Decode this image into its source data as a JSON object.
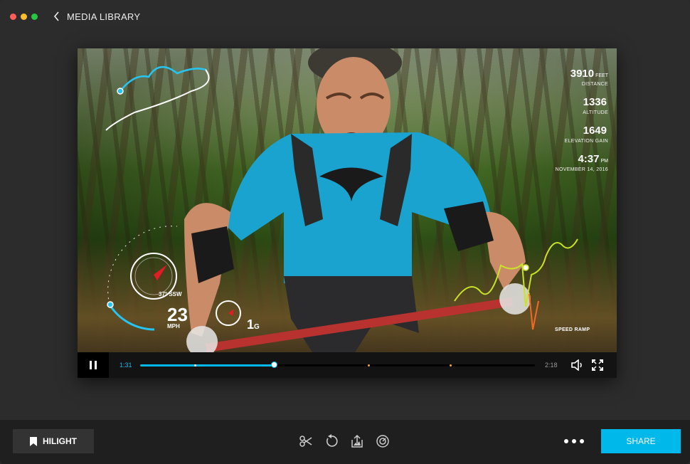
{
  "window": {
    "title": "MEDIA LIBRARY"
  },
  "player": {
    "current_time": "1:31",
    "total_time": "2:18",
    "progress": 0.34,
    "highlight_markers": [
      0.14,
      0.58,
      0.787
    ]
  },
  "overlay": {
    "stats": [
      {
        "value": "3910",
        "unit": "FEET",
        "label": "DISTANCE"
      },
      {
        "value": "1336",
        "unit": "",
        "label": "ALTITUDE"
      },
      {
        "value": "1649",
        "unit": "",
        "label": "ELEVATION GAIN"
      },
      {
        "value": "4:37",
        "unit": "PM",
        "label": "NOVEMBER 14, 2016"
      }
    ],
    "speed": "23",
    "speed_unit": "MPH",
    "heading": "37° SSW",
    "gforce": "1",
    "gforce_unit": "G",
    "speed_ramp_label": "SPEED RAMP"
  },
  "toolbar": {
    "hilight_label": "HILIGHT",
    "share_label": "SHARE"
  },
  "colors": {
    "accent": "#00b8ea",
    "marker": "#f2a33a"
  },
  "icons": {
    "back": "chevron-left-icon",
    "pause": "pause-icon",
    "volume": "speaker-icon",
    "fullscreen": "fullscreen-icon",
    "hilight": "tag-icon",
    "trim": "scissors-icon",
    "rotate": "rotate-icon",
    "export": "export-icon",
    "effects": "dial-icon",
    "more": "more-dots-icon"
  }
}
